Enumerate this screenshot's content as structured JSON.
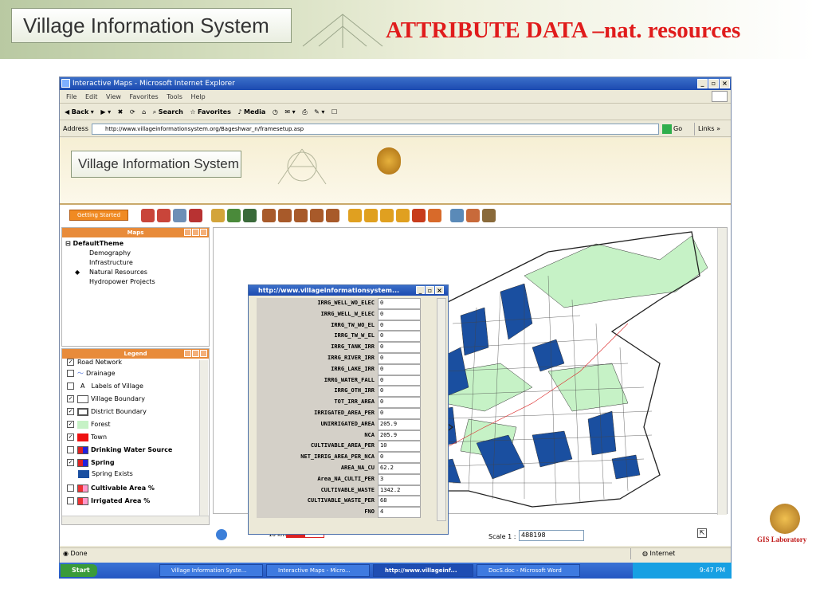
{
  "slide": {
    "brand": "Village Information System",
    "title": "ATTRIBUTE DATA –nat. resources",
    "footer_logo_text": "GIS Laboratory"
  },
  "browser": {
    "window_title": "Interactive Maps - Microsoft Internet Explorer",
    "menu": [
      "File",
      "Edit",
      "View",
      "Favorites",
      "Tools",
      "Help"
    ],
    "toolbar": [
      "Back",
      "Search",
      "Favorites",
      "Media"
    ],
    "address_label": "Address",
    "address_value": "http://www.villageinformationsystem.org/Bageshwar_n/framesetup.asp",
    "go_label": "Go",
    "links_label": "Links",
    "status_text": "Done",
    "zone_text": "Internet"
  },
  "app": {
    "header_title": "Village Information System",
    "getting_started": "Getting Started"
  },
  "maps_panel": {
    "title": "Maps",
    "root": "DefaultTheme",
    "items": [
      "Demography",
      "Infrastructure",
      "Natural Resources",
      "Hydropower Projects"
    ],
    "selected": "Natural Resources"
  },
  "legend": {
    "title": "Legend",
    "items": [
      {
        "label": "Road Network",
        "checked": true,
        "bold": false
      },
      {
        "label": "Drainage",
        "checked": false,
        "bold": false
      },
      {
        "label": "Labels of Village",
        "checked": false,
        "bold": false
      },
      {
        "label": "Village Boundary",
        "checked": true,
        "bold": false
      },
      {
        "label": "District Boundary",
        "checked": true,
        "bold": false
      },
      {
        "label": "Forest",
        "checked": true,
        "bold": false
      },
      {
        "label": "Town",
        "checked": true,
        "bold": false
      },
      {
        "label": "Drinking Water Source",
        "checked": false,
        "bold": true
      },
      {
        "label": "Spring",
        "checked": true,
        "bold": true
      },
      {
        "label": "Spring Exists",
        "checked": null,
        "bold": false
      },
      {
        "label": "Cultivable Area %",
        "checked": false,
        "bold": true
      },
      {
        "label": "Irrigated Area %",
        "checked": false,
        "bold": true
      }
    ],
    "colors": {
      "forest": "#c6f2c6",
      "town": "#ee1111",
      "spring": "#1a4fa0"
    }
  },
  "map": {
    "scale_label": "10 km",
    "scale_prefix": "Scale 1 :",
    "scale_value": "488198",
    "colors": {
      "forest": "#c6f2c6",
      "spring": "#1a4fa0",
      "boundary": "#333333",
      "town": "#ee1111"
    }
  },
  "popup": {
    "title": "http://www.villageinformationsystem...",
    "rows": [
      {
        "key": "IRRG_WELL_WO_ELEC",
        "value": "0"
      },
      {
        "key": "IRRG_WELL_W_ELEC",
        "value": "0"
      },
      {
        "key": "IRRG_TW_WO_EL",
        "value": "0"
      },
      {
        "key": "IRRG_TW_W_EL",
        "value": "0"
      },
      {
        "key": "IRRG_TANK_IRR",
        "value": "0"
      },
      {
        "key": "IRRG_RIVER_IRR",
        "value": "0"
      },
      {
        "key": "IRRG_LAKE_IRR",
        "value": "0"
      },
      {
        "key": "IRRG_WATER_FALL",
        "value": "0"
      },
      {
        "key": "IRRG_OTH_IRR",
        "value": "0"
      },
      {
        "key": "TOT_IRR_AREA",
        "value": "0"
      },
      {
        "key": "IRRIGATED_AREA_PER",
        "value": "0"
      },
      {
        "key": "UNIRRIGATED_AREA",
        "value": "205.9"
      },
      {
        "key": "NCA",
        "value": "205.9"
      },
      {
        "key": "CULTIVABLE_AREA_PER",
        "value": "10"
      },
      {
        "key": "NET_IRRIG_AREA_PER_NCA",
        "value": "0"
      },
      {
        "key": "AREA_NA_CU",
        "value": "62.2"
      },
      {
        "key": "Area_NA_CULTI_PER",
        "value": "3"
      },
      {
        "key": "CULTIVABLE_WASTE",
        "value": "1342.2"
      },
      {
        "key": "CULTIVABLE_WASTE_PER",
        "value": "68"
      },
      {
        "key": "FNO",
        "value": "4"
      }
    ]
  },
  "taskbar": {
    "start": "Start",
    "tasks": [
      {
        "label": "Village Information Syste...",
        "active": false
      },
      {
        "label": "Interactive Maps - Micro...",
        "active": false
      },
      {
        "label": "http://www.villageinf...",
        "active": true
      },
      {
        "label": "DocS.doc - Microsoft Word",
        "active": false
      }
    ],
    "clock": "9:47 PM"
  }
}
